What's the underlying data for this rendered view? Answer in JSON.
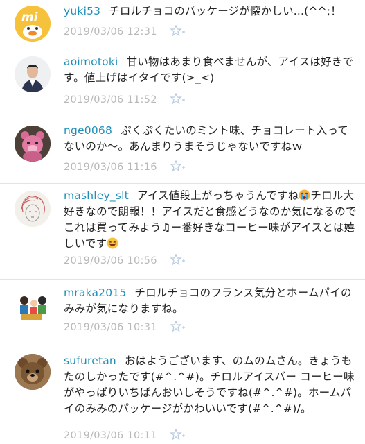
{
  "comments": [
    {
      "user": "yuki53",
      "text": "チロルチョコのパッケージが懐かしい...(^^;！",
      "date": "2019/03/06 12:31",
      "avatar_icon": "duck-mi-icon"
    },
    {
      "user": "aoimotoki",
      "text": "甘い物はあまり食べませんが、アイスは好きです。値上げはイタイです(>_<)",
      "date": "2019/03/06 11:52",
      "avatar_icon": "man-photo-icon"
    },
    {
      "user": "nge0068",
      "text": "ぷくぷくたいのミント味、チョコレート入ってないのか〜。あんまりうまそうじゃないですねｗ",
      "date": "2019/03/06 11:16",
      "avatar_icon": "pink-bear-icon"
    },
    {
      "user": "mashley_slt",
      "text_a": "アイス値段上がっちゃうんですね",
      "text_b": "チロル大好きなので朗報！！アイスだと食感どうなのか気になるのでこれは買ってみよう♫ー番好きなコーヒー味がアイスとは嬉しいです",
      "date": "2019/03/06 10:56",
      "avatar_icon": "sketch-face-icon"
    },
    {
      "user": "mraka2015",
      "text": "チロルチョコのフランス気分とホームパイのみみが気になりますね。",
      "date": "2019/03/06 10:31",
      "avatar_icon": "family-icon"
    },
    {
      "user": "sufuretan",
      "text": "おはようございます、のムのムさん。きょうもたのしかったです(#^.^#)。チロルアイスバー コーヒー味がやっぱりいちばんおいしそうですね(#^.^#)。ホームパイのみみのパッケージがかわいいです(#^.^#)/。",
      "date": "2019/03/06 10:11",
      "avatar_icon": "teddy-bear-icon"
    }
  ],
  "colors": {
    "username": "#1f8fb8",
    "meta": "#b8b8b8",
    "star": "#b9cbe0"
  }
}
